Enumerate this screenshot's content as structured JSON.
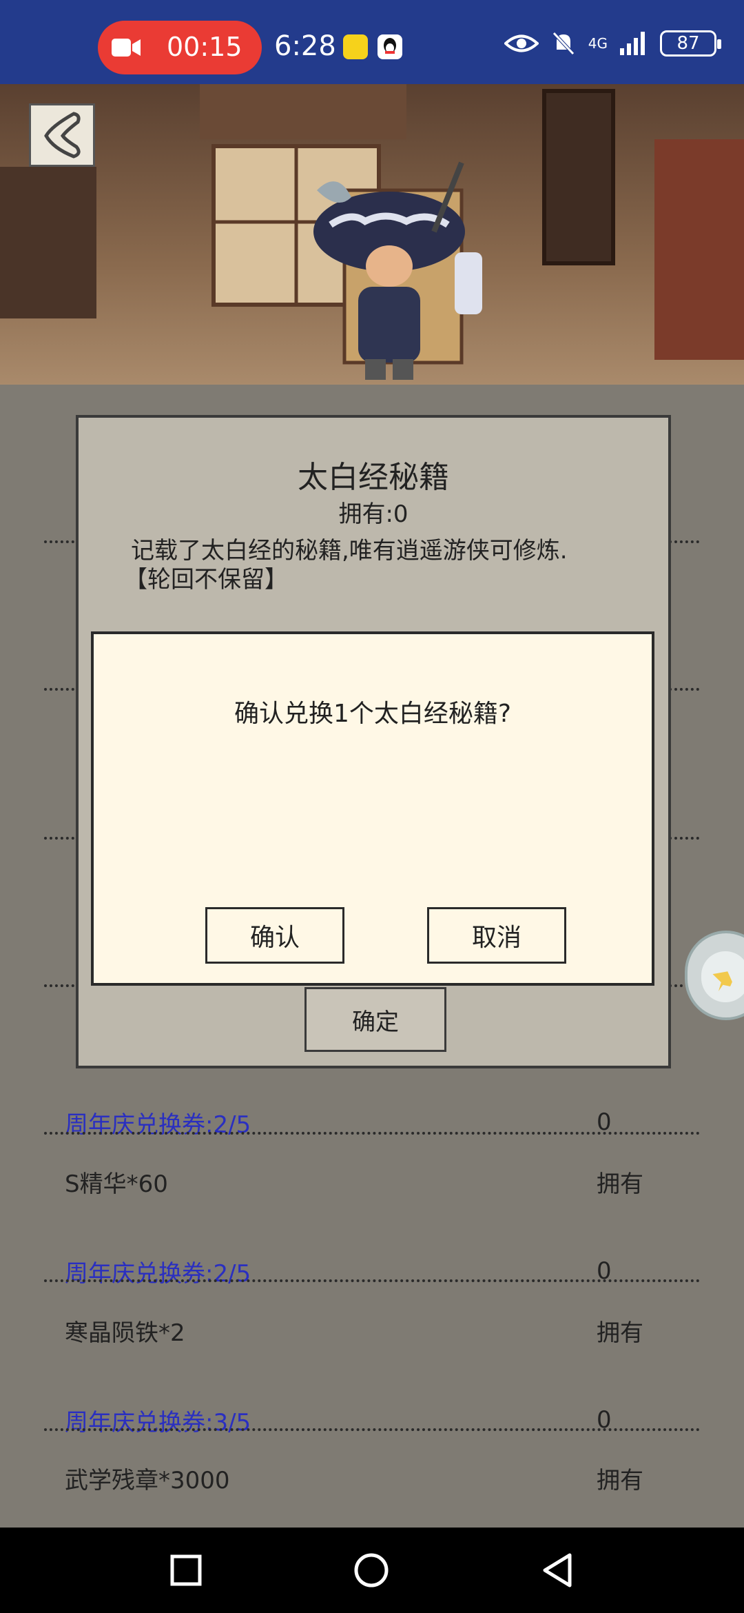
{
  "status_bar": {
    "record_time": "00:15",
    "clock": "6:28",
    "network": "4G",
    "battery": "87",
    "colors": {
      "bar": "#233b8c",
      "record_pill": "#ea3b34"
    }
  },
  "scene": {
    "back_icon": "chevron-left-icon",
    "character": "traveling-merchant-illustration"
  },
  "list": [
    {
      "item": "S精华*60",
      "status": "拥有",
      "cost": "周年庆兑换券:2/5",
      "owned": "0"
    },
    {
      "item": "寒晶陨铁*2",
      "status": "拥有",
      "cost": "周年庆兑换券:3/5",
      "owned": "0"
    },
    {
      "item": "武学残章*3000",
      "status": "拥有"
    }
  ],
  "partial_list": {
    "top_cost": "周年庆兑换券:2/5",
    "top_owned": "0"
  },
  "dialog": {
    "title": "太白经秘籍",
    "owned": "拥有:0",
    "description": "记载了太白经的秘籍,唯有逍遥游侠可修炼.",
    "note": "【轮回不保留】",
    "ok": "确定"
  },
  "confirm": {
    "question": "确认兑换1个太白经秘籍?",
    "confirm": "确认",
    "cancel": "取消"
  },
  "nav": {
    "icons": [
      "recent-apps-icon",
      "home-icon",
      "back-icon"
    ]
  }
}
